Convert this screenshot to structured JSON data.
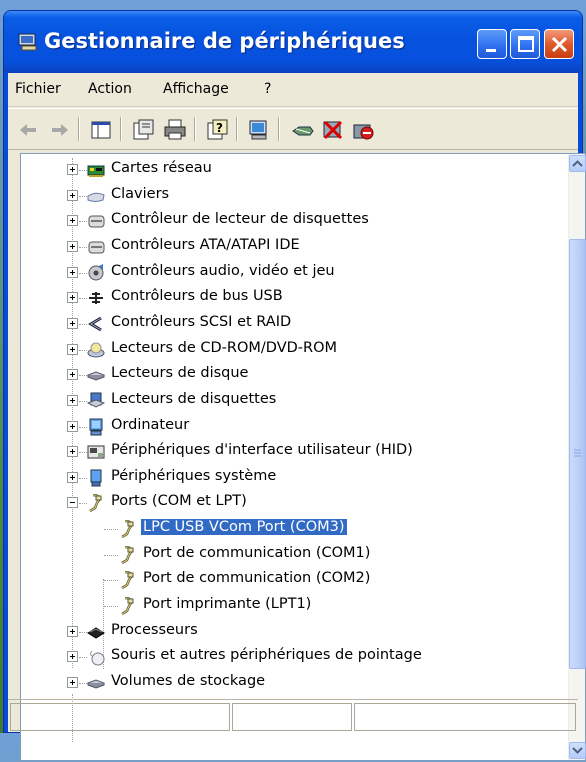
{
  "window": {
    "title": "Gestionnaire de périphériques",
    "controls": [
      "minimize-icon",
      "maximize-icon",
      "close-icon"
    ]
  },
  "menu": {
    "items": [
      "Fichier",
      "Action",
      "Affichage",
      "?"
    ]
  },
  "toolbar": {
    "icons": [
      "back-arrow-icon",
      "forward-arrow-icon",
      "console-tree-icon",
      "properties-icon",
      "print-icon",
      "help-icon",
      "scan-hardware-icon",
      "update-driver-icon",
      "uninstall-icon",
      "disable-icon"
    ]
  },
  "tree": {
    "items": [
      {
        "label": "Cartes réseau",
        "icon": "network-card-icon",
        "level": 0,
        "expander": "plus"
      },
      {
        "label": "Claviers",
        "icon": "keyboard-icon",
        "level": 0,
        "expander": "plus"
      },
      {
        "label": "Contrôleur de lecteur de disquettes",
        "icon": "floppy-controller-icon",
        "level": 0,
        "expander": "plus"
      },
      {
        "label": "Contrôleurs ATA/ATAPI IDE",
        "icon": "ide-controller-icon",
        "level": 0,
        "expander": "plus"
      },
      {
        "label": "Contrôleurs audio, vidéo et jeu",
        "icon": "audio-video-icon",
        "level": 0,
        "expander": "plus"
      },
      {
        "label": "Contrôleurs de bus USB",
        "icon": "usb-icon",
        "level": 0,
        "expander": "plus"
      },
      {
        "label": "Contrôleurs SCSI et RAID",
        "icon": "scsi-icon",
        "level": 0,
        "expander": "plus"
      },
      {
        "label": "Lecteurs de CD-ROM/DVD-ROM",
        "icon": "cdrom-icon",
        "level": 0,
        "expander": "plus"
      },
      {
        "label": "Lecteurs de disque",
        "icon": "disk-drive-icon",
        "level": 0,
        "expander": "plus"
      },
      {
        "label": "Lecteurs de disquettes",
        "icon": "floppy-drive-icon",
        "level": 0,
        "expander": "plus"
      },
      {
        "label": "Ordinateur",
        "icon": "computer-icon",
        "level": 0,
        "expander": "plus"
      },
      {
        "label": "Périphériques d'interface utilisateur (HID)",
        "icon": "hid-icon",
        "level": 0,
        "expander": "plus"
      },
      {
        "label": "Périphériques système",
        "icon": "system-device-icon",
        "level": 0,
        "expander": "plus"
      },
      {
        "label": "Ports (COM et LPT)",
        "icon": "port-icon",
        "level": 0,
        "expander": "minus"
      },
      {
        "label": "LPC USB VCom Port (COM3)",
        "icon": "port-icon",
        "level": 1,
        "selected": true
      },
      {
        "label": "Port de communication (COM1)",
        "icon": "port-icon",
        "level": 1
      },
      {
        "label": "Port de communication (COM2)",
        "icon": "port-icon",
        "level": 1
      },
      {
        "label": "Port imprimante (LPT1)",
        "icon": "port-icon",
        "level": 1
      },
      {
        "label": "Processeurs",
        "icon": "processor-icon",
        "level": 0,
        "expander": "plus"
      },
      {
        "label": "Souris et autres périphériques de pointage",
        "icon": "mouse-icon",
        "level": 0,
        "expander": "plus"
      },
      {
        "label": "Volumes de stockage",
        "icon": "storage-volume-icon",
        "level": 0,
        "expander": "plus"
      }
    ]
  },
  "colors": {
    "titlebar": "#0653df",
    "selection": "#316ac5",
    "client": "#ece9d8"
  }
}
